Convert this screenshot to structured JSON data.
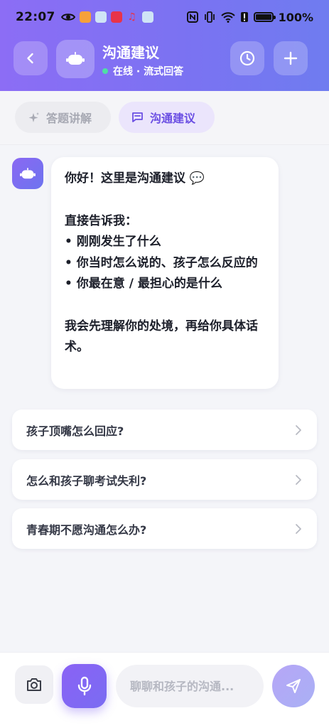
{
  "status_bar": {
    "time": "22:07",
    "battery_percent": "100%"
  },
  "header": {
    "title": "沟通建议",
    "status_text": "在线 · 流式回答",
    "status_color": "#4ee0a4",
    "gradient_start": "#8c6df5",
    "gradient_end": "#6f7cf0"
  },
  "tabs": [
    {
      "label": "答题讲解",
      "icon": "sparkle-icon",
      "active": false
    },
    {
      "label": "沟通建议",
      "icon": "chat-icon",
      "active": true
    }
  ],
  "message": {
    "greeting_prefix": "你好！这里是",
    "greeting_bold": "沟通建议",
    "greeting_emoji": "💬",
    "intro": "直接告诉我：",
    "bullets": [
      "• 刚刚发生了什么",
      "• 你当时怎么说的、孩子怎么反应的",
      "• 你最在意 / 最担心的是什么"
    ],
    "closing": "我会先理解你的处境，再给你具体话术。"
  },
  "quick_replies": [
    "孩子顶嘴怎么回应?",
    "怎么和孩子聊考试失利?",
    "青春期不愿沟通怎么办?"
  ],
  "composer": {
    "placeholder": "聊聊和孩子的沟通..."
  }
}
